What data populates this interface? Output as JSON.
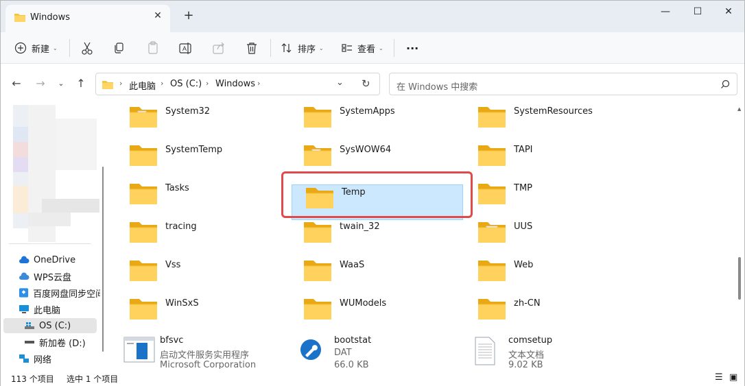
{
  "window": {
    "tab_title": "Windows",
    "controls": {
      "minimize": "—",
      "maximize": "☐",
      "close": "✕"
    }
  },
  "toolbar": {
    "new_label": "新建",
    "sort_label": "排序",
    "view_label": "查看",
    "more_label": "···"
  },
  "address": {
    "crumbs": [
      "此电脑",
      "OS (C:)",
      "Windows"
    ],
    "separator": "›"
  },
  "search": {
    "placeholder": "在 Windows 中搜索"
  },
  "sidebar": {
    "items": [
      {
        "label": "OneDrive",
        "icon": "cloud-icon"
      },
      {
        "label": "WPS云盘",
        "icon": "cloud-icon"
      },
      {
        "label": "百度网盘同步空间",
        "icon": "baidu-icon"
      },
      {
        "label": "此电脑",
        "icon": "pc-icon"
      },
      {
        "label": "OS (C:)",
        "icon": "drive-icon"
      },
      {
        "label": "新加卷 (D:)",
        "icon": "drive-icon"
      },
      {
        "label": "网络",
        "icon": "network-icon"
      }
    ]
  },
  "files": {
    "rows": [
      [
        "System32",
        "SystemApps",
        "SystemResources"
      ],
      [
        "SystemTemp",
        "SysWOW64",
        "TAPI"
      ],
      [
        "Tasks",
        "Temp",
        "TMP"
      ],
      [
        "tracing",
        "twain_32",
        "UUS"
      ],
      [
        "Vss",
        "WaaS",
        "Web"
      ],
      [
        "WinSxS",
        "WUModels",
        "zh-CN"
      ]
    ],
    "selected": "Temp",
    "last_row": [
      {
        "name": "bfsvc",
        "line2": "启动文件服务实用程序",
        "line3": "Microsoft Corporation"
      },
      {
        "name": "bootstat",
        "line2": "DAT",
        "line3": "66.0 KB"
      },
      {
        "name": "comsetup",
        "line2": "文本文档",
        "line3": "9.02 KB"
      }
    ]
  },
  "status": {
    "count": "113 个项目",
    "selected": "选中 1 个项目"
  },
  "colors": {
    "folder": "#f4c542",
    "folder_dark": "#e8a915",
    "selection": "#cce8ff",
    "highlight": "#e04a4a"
  }
}
